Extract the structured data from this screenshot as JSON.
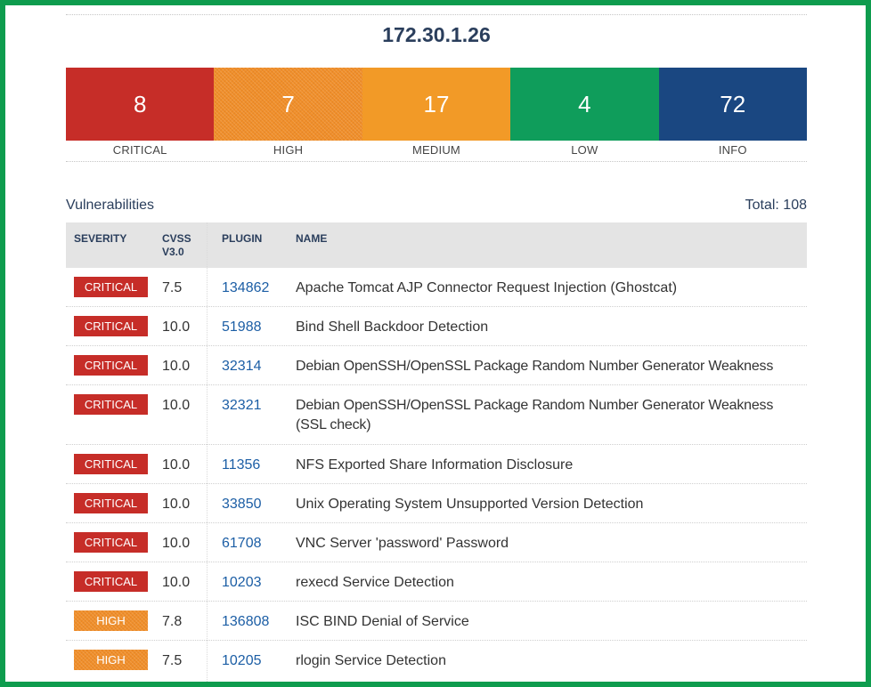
{
  "host": {
    "title": "172.30.1.26"
  },
  "summary": [
    {
      "count": "8",
      "label": "CRITICAL",
      "color": "#c62d28",
      "pattern": "solid"
    },
    {
      "count": "7",
      "label": "HIGH",
      "color": "#f08f2a",
      "pattern": "hatched"
    },
    {
      "count": "17",
      "label": "MEDIUM",
      "color": "#f29a27",
      "pattern": "solid"
    },
    {
      "count": "4",
      "label": "LOW",
      "color": "#0f9d5b",
      "pattern": "solid"
    },
    {
      "count": "72",
      "label": "INFO",
      "color": "#1a4781",
      "pattern": "solid"
    }
  ],
  "vulnerabilities": {
    "heading": "Vulnerabilities",
    "total": "Total: 108",
    "columns": {
      "severity": "SEVERITY",
      "cvss_line1": "CVSS",
      "cvss_line2": "V3.0",
      "plugin": "PLUGIN",
      "name": "NAME"
    },
    "rows": [
      {
        "severity": "CRITICAL",
        "cvss": "7.5",
        "plugin": "134862",
        "name": "Apache Tomcat AJP Connector Request Injection (Ghostcat)"
      },
      {
        "severity": "CRITICAL",
        "cvss": "10.0",
        "plugin": "51988",
        "name": "Bind Shell Backdoor Detection"
      },
      {
        "severity": "CRITICAL",
        "cvss": "10.0",
        "plugin": "32314",
        "name": "Debian OpenSSH/OpenSSL Package Random Number Generator Weakness"
      },
      {
        "severity": "CRITICAL",
        "cvss": "10.0",
        "plugin": "32321",
        "name": "Debian OpenSSH/OpenSSL Package Random Number Generator Weakness (SSL check)"
      },
      {
        "severity": "CRITICAL",
        "cvss": "10.0",
        "plugin": "11356",
        "name": "NFS Exported Share Information Disclosure"
      },
      {
        "severity": "CRITICAL",
        "cvss": "10.0",
        "plugin": "33850",
        "name": "Unix Operating System Unsupported Version Detection"
      },
      {
        "severity": "CRITICAL",
        "cvss": "10.0",
        "plugin": "61708",
        "name": "VNC Server 'password' Password"
      },
      {
        "severity": "CRITICAL",
        "cvss": "10.0",
        "plugin": "10203",
        "name": "rexecd Service Detection"
      },
      {
        "severity": "HIGH",
        "cvss": "7.8",
        "plugin": "136808",
        "name": "ISC BIND Denial of Service"
      },
      {
        "severity": "HIGH",
        "cvss": "7.5",
        "plugin": "10205",
        "name": "rlogin Service Detection"
      }
    ]
  },
  "frame_color": "#0e9c4e"
}
